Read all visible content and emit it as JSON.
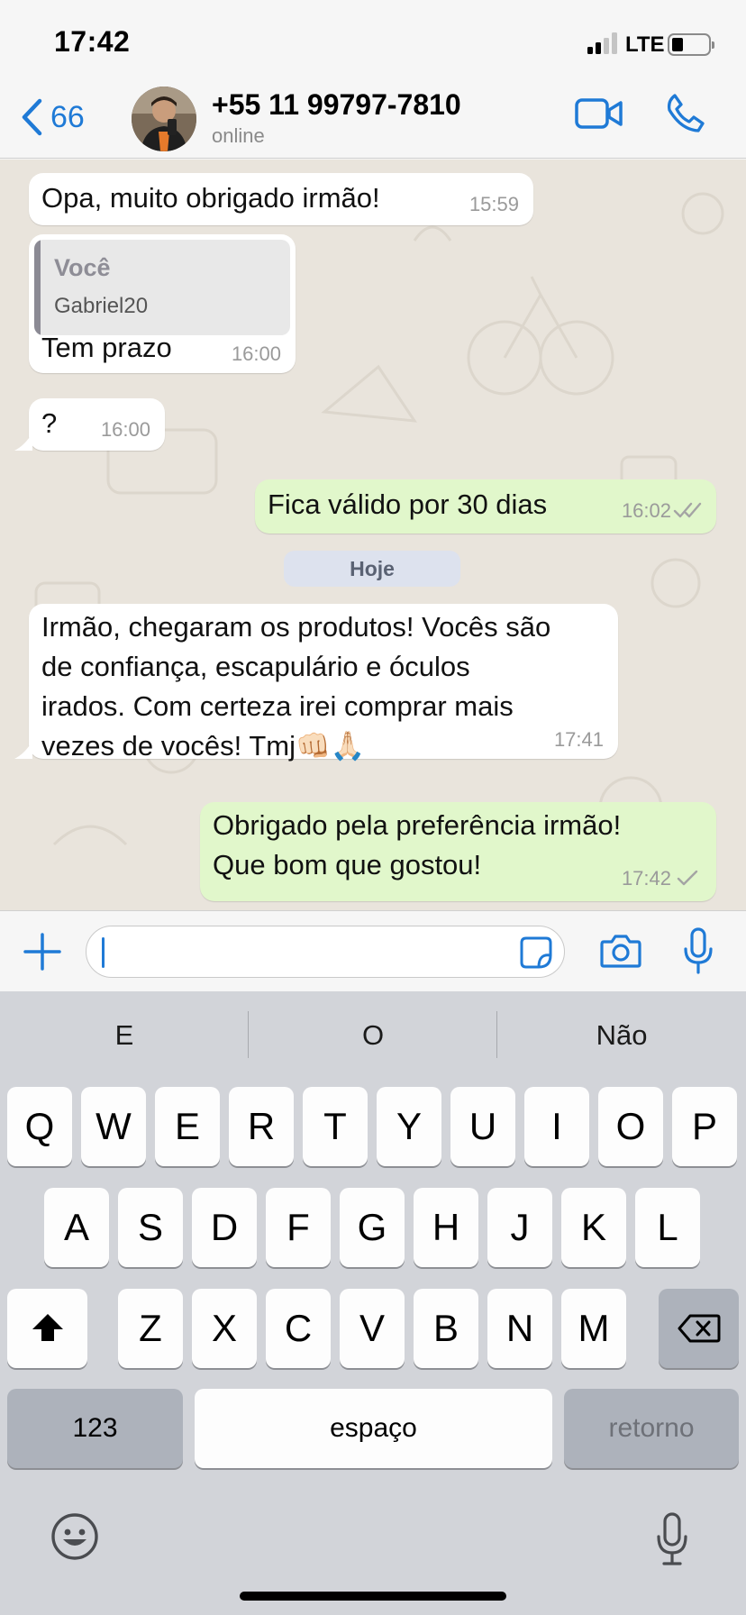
{
  "status_bar": {
    "time": "17:42",
    "network": "LTE",
    "signal_bars_active": 2,
    "signal_bars_total": 4,
    "battery_level": 0.25
  },
  "header": {
    "back_count": "66",
    "back_icon": "chevron-left-icon",
    "contact_name": "+55 11 99797-7810",
    "contact_status": "online",
    "video_icon": "video-camera-icon",
    "call_icon": "phone-icon"
  },
  "messages": [
    {
      "direction": "incoming",
      "text": "Opa, muito obrigado irmão!",
      "time": "15:59"
    },
    {
      "direction": "incoming",
      "quote_author": "Você",
      "quote_text": "Gabriel20",
      "text": "Tem prazo",
      "time": "16:00"
    },
    {
      "direction": "incoming",
      "text": "?",
      "time": "16:00"
    },
    {
      "direction": "outgoing",
      "text": "Fica válido por 30 dias",
      "time": "16:02",
      "status": "read"
    },
    {
      "direction": "incoming",
      "lines": [
        "Irmão, chegaram os produtos! Vocês são",
        "de confiança, escapulário e óculos",
        "irados. Com certeza irei comprar mais",
        "vezes de vocês! Tmj👊🏻🙏🏻"
      ],
      "time": "17:41"
    },
    {
      "direction": "outgoing",
      "lines": [
        "Obrigado pela preferência irmão!",
        "Que bom que gostou!"
      ],
      "time": "17:42",
      "status": "sent"
    }
  ],
  "date_separator": "Hoje",
  "input_bar": {
    "plus_icon": "plus-icon",
    "message_value": "",
    "sticker_icon": "sticker-icon",
    "camera_icon": "camera-icon",
    "mic_icon": "microphone-icon"
  },
  "keyboard": {
    "suggestions": [
      "E",
      "O",
      "Não"
    ],
    "row1": [
      "Q",
      "W",
      "E",
      "R",
      "T",
      "Y",
      "U",
      "I",
      "O",
      "P"
    ],
    "row2": [
      "A",
      "S",
      "D",
      "F",
      "G",
      "H",
      "J",
      "K",
      "L"
    ],
    "row3": [
      "Z",
      "X",
      "C",
      "V",
      "B",
      "N",
      "M"
    ],
    "numbers_label": "123",
    "space_label": "espaço",
    "return_label": "retorno",
    "shift_icon": "shift-icon",
    "delete_icon": "backspace-icon",
    "emoji_icon": "emoji-icon",
    "dictation_icon": "microphone-icon"
  },
  "colors": {
    "accent": "#1f7ad6",
    "outgoing_bubble": "#e1f7cb",
    "incoming_bubble": "#ffffff",
    "chat_background": "#e9e4dc",
    "read_ticks": "#7fb4d9"
  }
}
